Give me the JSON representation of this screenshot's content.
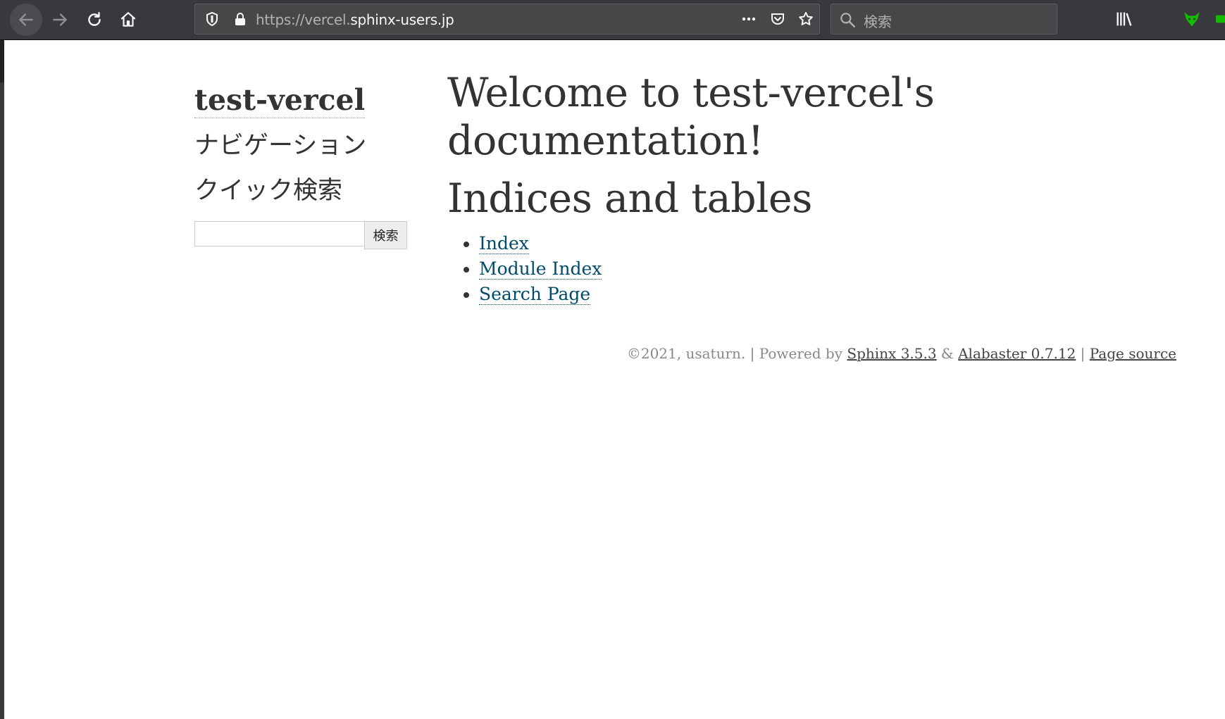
{
  "browser": {
    "url_prefix": "https://vercel.",
    "url_domain": "sphinx-users.jp",
    "search_placeholder": "検索",
    "icons": {
      "back": "back-arrow-icon",
      "forward": "forward-arrow-icon",
      "reload": "reload-icon",
      "home": "home-icon",
      "shield": "tracking-shield-icon",
      "lock": "lock-icon",
      "more": "more-actions-icon",
      "pocket": "pocket-icon",
      "bookmark": "bookmark-star-icon",
      "search": "search-icon",
      "library": "library-icon",
      "sidebar": "sidebar-icon",
      "extension": "extension-fox-icon"
    }
  },
  "sidebar": {
    "project_name": "test-vercel",
    "navigation_heading": "ナビゲーション",
    "quick_search_heading": "クイック検索",
    "search_button_label": "検索",
    "search_value": ""
  },
  "main": {
    "title": "Welcome to test-vercel's documentation!",
    "indices_heading": "Indices and tables",
    "links": [
      {
        "label": "Index"
      },
      {
        "label": "Module Index"
      },
      {
        "label": "Search Page"
      }
    ]
  },
  "footer": {
    "copyright": "©2021, usaturn.",
    "sep1": " | Powered by ",
    "sphinx_link": "Sphinx 3.5.3",
    "amp": " & ",
    "alabaster_link": "Alabaster 0.7.12",
    "sep2": " | ",
    "source_link": "Page source"
  },
  "colors": {
    "toolbar_bg": "#38383d",
    "link": "#004b6b",
    "text": "#333333",
    "footer_text": "#888888"
  }
}
